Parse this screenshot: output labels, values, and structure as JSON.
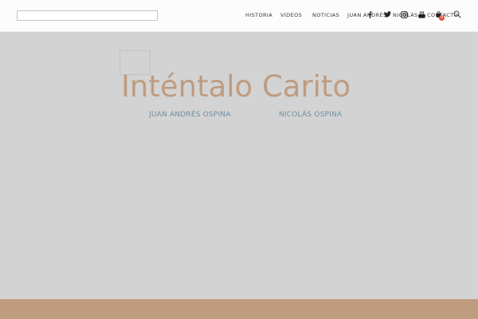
{
  "header": {
    "nav": [
      {
        "label": "HISTORIA"
      },
      {
        "label": "VIDEOS"
      },
      {
        "label": "NOTICIAS"
      },
      {
        "label": "JUAN ANDRÉS"
      },
      {
        "label": "NICOLÁS"
      },
      {
        "label": "CONTACTO"
      }
    ],
    "social_icons": [
      "facebook-icon",
      "twitter-icon",
      "instagram-icon",
      "youtube-icon"
    ],
    "cart": {
      "icon": "cart-icon",
      "count": "0"
    },
    "search_icon": "search-icon"
  },
  "hero": {
    "title": "Inténtalo Carito",
    "authors": [
      "JUAN ANDRÉS OSPINA",
      "NICOLÁS OSPINA"
    ]
  },
  "colors": {
    "header_bg": "#fcfcfc",
    "hero_bg": "#d3d3d3",
    "accent": "#bf9c80",
    "author_text": "#6e8ea3",
    "badge": "#e05238"
  }
}
